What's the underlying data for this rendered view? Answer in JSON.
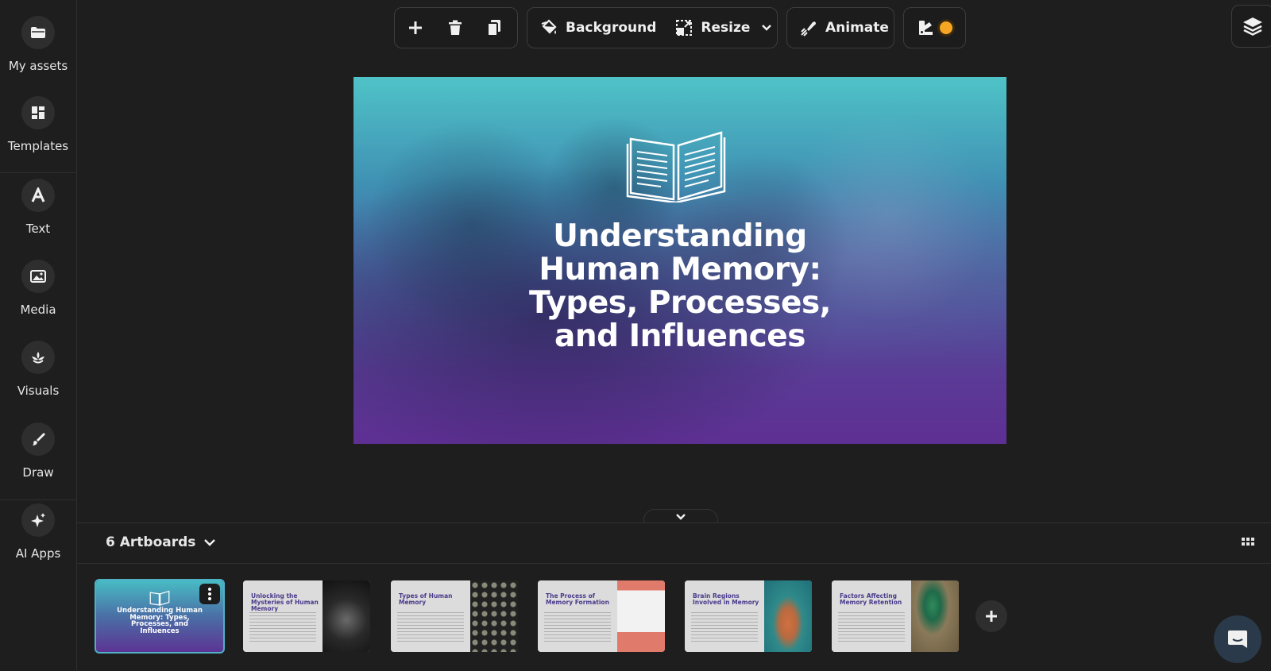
{
  "sidebar": {
    "items": [
      {
        "label": "My assets",
        "icon": "folder-icon"
      },
      {
        "label": "Templates",
        "icon": "templates-icon"
      },
      {
        "label": "Text",
        "icon": "text-icon"
      },
      {
        "label": "Media",
        "icon": "image-icon"
      },
      {
        "label": "Visuals",
        "icon": "visuals-icon"
      },
      {
        "label": "Draw",
        "icon": "brush-icon"
      },
      {
        "label": "AI Apps",
        "icon": "sparkle-icon"
      }
    ]
  },
  "toolbar": {
    "background_label": "Background",
    "resize_label": "Resize",
    "animate_label": "Animate"
  },
  "canvas": {
    "title_lines": [
      "Understanding",
      "Human Memory:",
      "Types, Processes,",
      "and Influences"
    ]
  },
  "artboards": {
    "count_label": "6 Artboards",
    "thumbnails": [
      {
        "title": "Understanding Human Memory: Types, Processes, and Influences"
      },
      {
        "title": "Unlocking the Mysteries of Human Memory"
      },
      {
        "title": "Types of Human Memory"
      },
      {
        "title": "The Process of Memory Formation"
      },
      {
        "title": "Brain Regions Involved in Memory"
      },
      {
        "title": "Factors Affecting Memory Retention"
      }
    ]
  },
  "colors": {
    "accent_orange": "#f5a623",
    "canvas_top": "#4fc3c7",
    "canvas_bottom": "#5e2f93",
    "thumb_title": "#4a3a8c"
  }
}
